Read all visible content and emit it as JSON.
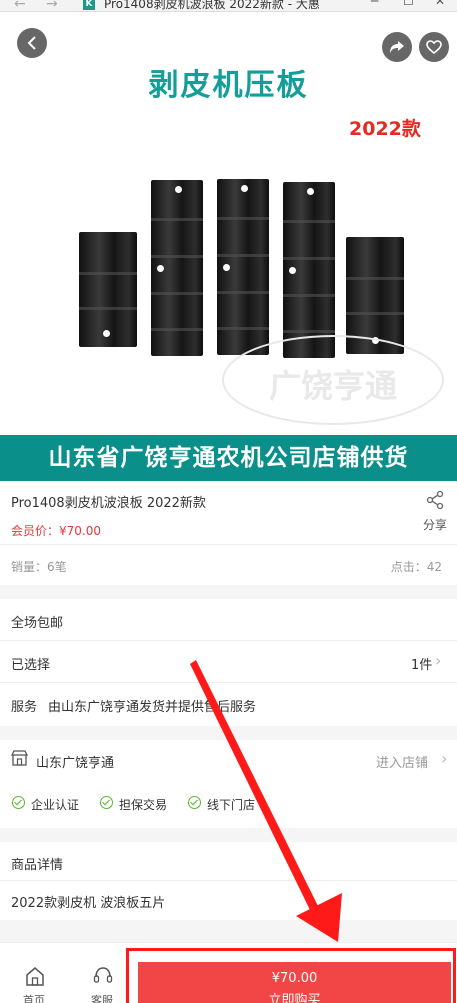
{
  "window": {
    "tab_title": "Pro1408剥皮机波浪板 2022新款 - 大惠",
    "back_glyph": "←",
    "forward_glyph": "→",
    "logo_text": "K",
    "minimize_glyph": "─",
    "maximize_glyph": "☐",
    "close_glyph": "✕"
  },
  "hero": {
    "headline": "剥皮机压板",
    "year_badge": "2022款",
    "watermark": "广饶亨通",
    "banner": "山东省广饶亨通农机公司店铺供货"
  },
  "product": {
    "title": "Pro1408剥皮机波浪板 2022新款",
    "member_price": "会员价：¥70.00",
    "share_label": "分享",
    "sales": "销量：6笔",
    "clicks": "点击：42"
  },
  "info_rows": {
    "free_shipping": "全场包邮",
    "selected_label": "已选择",
    "selected_value": "1件",
    "service_label": "服务",
    "service_text": "由山东广饶亨通发货并提供售后服务"
  },
  "store": {
    "name": "山东广饶亨通",
    "enter_link": "进入店铺",
    "badges": [
      "企业认证",
      "担保交易",
      "线下门店"
    ]
  },
  "details": {
    "heading": "商品详情",
    "text": "2022款剥皮机 波浪板五片"
  },
  "bottom": {
    "home_label": "首页",
    "service_label": "客服",
    "buy_price": "¥70.00",
    "buy_label": "立即购买"
  },
  "colors": {
    "accent_red": "#f24646",
    "teal_banner": "#0a8f8a",
    "price_red": "#e4393c",
    "check_green": "#5cb531"
  }
}
